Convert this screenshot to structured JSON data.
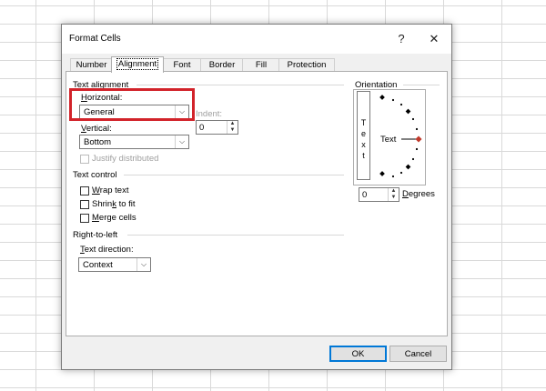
{
  "dialog": {
    "title": "Format Cells",
    "help_label": "?",
    "close_label": "✕"
  },
  "tabs": [
    {
      "label": "Number"
    },
    {
      "label": "Alignment"
    },
    {
      "label": "Font"
    },
    {
      "label": "Border"
    },
    {
      "label": "Fill"
    },
    {
      "label": "Protection"
    }
  ],
  "active_tab": "Alignment",
  "text_alignment": {
    "section_label": "Text alignment",
    "horizontal": {
      "label_u": "H",
      "label_rest": "orizontal:",
      "value": "General"
    },
    "indent": {
      "label": "Indent:",
      "value": "0"
    },
    "vertical": {
      "label_u": "V",
      "label_rest": "ertical:",
      "value": "Bottom"
    },
    "justify_distributed": {
      "label": "Justify distributed",
      "checked": false,
      "enabled": false
    }
  },
  "text_control": {
    "section_label": "Text control",
    "wrap_text": {
      "label_u": "W",
      "label_rest": "rap text",
      "checked": false
    },
    "shrink_to_fit": {
      "label_pre": "Shrin",
      "label_u": "k",
      "label_rest": " to fit",
      "checked": false
    },
    "merge_cells": {
      "label_u": "M",
      "label_rest": "erge cells",
      "checked": false
    }
  },
  "right_to_left": {
    "section_label": "Right-to-left",
    "text_direction": {
      "label_u": "T",
      "label_rest": "ext direction:",
      "value": "Context"
    }
  },
  "orientation": {
    "section_label": "Orientation",
    "vertical_text": [
      "T",
      "e",
      "x",
      "t"
    ],
    "dial_text": "Text",
    "degrees_value": "0",
    "degrees_label_u": "D",
    "degrees_label_rest": "egrees"
  },
  "buttons": {
    "ok": "OK",
    "cancel": "Cancel"
  },
  "colors": {
    "highlight": "#d2232a",
    "dial_marker": "#c0392b",
    "ok_border": "#0078d7"
  }
}
